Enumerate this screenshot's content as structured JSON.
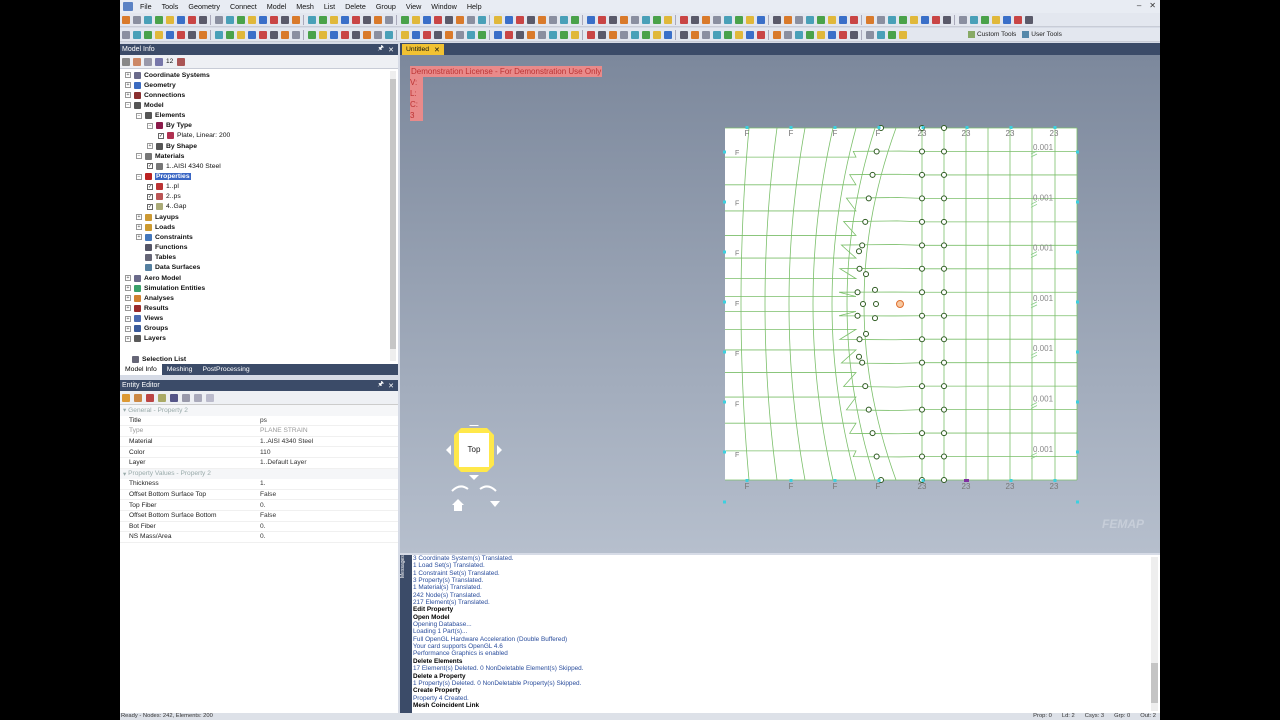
{
  "menu": [
    "File",
    "Tools",
    "Geometry",
    "Connect",
    "Model",
    "Mesh",
    "List",
    "Delete",
    "Group",
    "View",
    "Window",
    "Help"
  ],
  "toolbar": {
    "custom_tools": "Custom Tools",
    "user_tools": "User Tools"
  },
  "model_info": {
    "title": "Model Info",
    "tree": [
      {
        "label": "Coordinate Systems",
        "level": 0,
        "bold": true
      },
      {
        "label": "Geometry",
        "level": 0,
        "bold": true
      },
      {
        "label": "Connections",
        "level": 0,
        "bold": true
      },
      {
        "label": "Model",
        "level": 0,
        "bold": true
      },
      {
        "label": "Elements",
        "level": 1,
        "bold": true
      },
      {
        "label": "By Type",
        "level": 2,
        "bold": true
      },
      {
        "label": "Plate, Linear: 200",
        "level": 3,
        "bold": false
      },
      {
        "label": "By Shape",
        "level": 2,
        "bold": true
      },
      {
        "label": "Materials",
        "level": 1,
        "bold": true
      },
      {
        "label": "1..AISI 4340 Steel",
        "level": 2,
        "bold": false
      },
      {
        "label": "Properties",
        "level": 1,
        "bold": true,
        "selected": true
      },
      {
        "label": "1..pl",
        "level": 2,
        "bold": false
      },
      {
        "label": "2..ps",
        "level": 2,
        "bold": false
      },
      {
        "label": "4..Gap",
        "level": 2,
        "bold": false
      },
      {
        "label": "Layups",
        "level": 1,
        "bold": true
      },
      {
        "label": "Loads",
        "level": 1,
        "bold": true
      },
      {
        "label": "Constraints",
        "level": 1,
        "bold": true
      },
      {
        "label": "Functions",
        "level": 1,
        "bold": true
      },
      {
        "label": "Tables",
        "level": 1,
        "bold": true
      },
      {
        "label": "Data Surfaces",
        "level": 1,
        "bold": true
      },
      {
        "label": "Aero Model",
        "level": 0,
        "bold": true
      },
      {
        "label": "Simulation Entities",
        "level": 0,
        "bold": true
      },
      {
        "label": "Analyses",
        "level": 0,
        "bold": true
      },
      {
        "label": "Results",
        "level": 0,
        "bold": true
      },
      {
        "label": "Views",
        "level": 0,
        "bold": true
      },
      {
        "label": "Groups",
        "level": 0,
        "bold": true
      },
      {
        "label": "Layers",
        "level": 0,
        "bold": true
      }
    ],
    "selection_list": "Selection List",
    "tabs": [
      "Model Info",
      "Meshing",
      "PostProcessing"
    ],
    "toolbar_count": "12"
  },
  "entity_editor": {
    "title": "Entity Editor",
    "section_general": "General - Property 2",
    "general": [
      {
        "key": "Title",
        "value": "ps"
      },
      {
        "key": "Type",
        "value": "PLANE STRAIN",
        "grey": true
      },
      {
        "key": "Material",
        "value": "1..AISI 4340 Steel"
      },
      {
        "key": "Color",
        "value": "110"
      },
      {
        "key": "Layer",
        "value": "1..Default Layer"
      }
    ],
    "section_values": "Property Values - Property 2",
    "values": [
      {
        "key": "Thickness",
        "value": "1."
      },
      {
        "key": "Offset Bottom Surface Top",
        "value": "False"
      },
      {
        "key": "Top Fiber",
        "value": "0."
      },
      {
        "key": "Offset Bottom Surface Bottom",
        "value": "False"
      },
      {
        "key": "Bot Fiber",
        "value": "0."
      },
      {
        "key": "NS Mass/Area",
        "value": "0."
      }
    ]
  },
  "document_tab": "Untitled",
  "viewport": {
    "license": "Demonstration License - For Demonstration Use Only",
    "info": [
      "V: 2",
      "L: 2",
      "C: 3"
    ],
    "view_label": "Top",
    "watermark": "FEMAP",
    "top_labels": [
      "F",
      "F",
      "F",
      "F",
      "23",
      "23",
      "23",
      "23"
    ],
    "bottom_labels": [
      "F",
      "F",
      "F",
      "F",
      "23",
      "23",
      "23",
      "23"
    ],
    "load_labels": [
      "0.001",
      "0.001",
      "0.001",
      "0.001",
      "0.001",
      "0.001",
      "0.001"
    ]
  },
  "messages": {
    "side_label": "Messages",
    "lines": [
      {
        "t": "3 Coordinate System(s) Translated.",
        "b": false
      },
      {
        "t": "1 Load Set(s) Translated.",
        "b": false
      },
      {
        "t": "1 Constraint Set(s) Translated.",
        "b": false
      },
      {
        "t": "3 Property(s) Translated.",
        "b": false
      },
      {
        "t": "1 Material(s) Translated.",
        "b": false
      },
      {
        "t": "242 Node(s) Translated.",
        "b": false
      },
      {
        "t": "217 Element(s) Translated.",
        "b": false
      },
      {
        "t": "Edit Property",
        "b": true
      },
      {
        "t": "Open Model",
        "b": true
      },
      {
        "t": "Opening Database...",
        "b": false
      },
      {
        "t": "Loading 1 Part(s)...",
        "b": false
      },
      {
        "t": "Full OpenGL Hardware Acceleration (Double Buffered)",
        "b": false
      },
      {
        "t": "Your card supports OpenGL 4.6",
        "b": false
      },
      {
        "t": "Performance Graphics is enabled",
        "b": false
      },
      {
        "t": "Delete Elements",
        "b": true
      },
      {
        "t": "17 Element(s) Deleted. 0 NonDeletable Element(s) Skipped.",
        "b": false
      },
      {
        "t": "Delete a Property",
        "b": true
      },
      {
        "t": "1 Property(s) Deleted. 0 NonDeletable Property(s) Skipped.",
        "b": false
      },
      {
        "t": "Create Property",
        "b": true
      },
      {
        "t": "Property 4 Created.",
        "b": false
      },
      {
        "t": "Mesh Coincident Link",
        "b": true
      }
    ]
  },
  "status": {
    "left": "Ready - Nodes: 242, Elements: 200",
    "right": [
      "Prop: 0",
      "Ld: 2",
      "Csys: 3",
      "Grp: 0",
      "Out: 2"
    ]
  },
  "colors": {
    "panel_header": "#3b4b68",
    "mesh_line": "#7bbf6a",
    "node_marker": "#2d5a20",
    "constraint": "#3cd0e0",
    "tab_active": "#f1c232"
  }
}
